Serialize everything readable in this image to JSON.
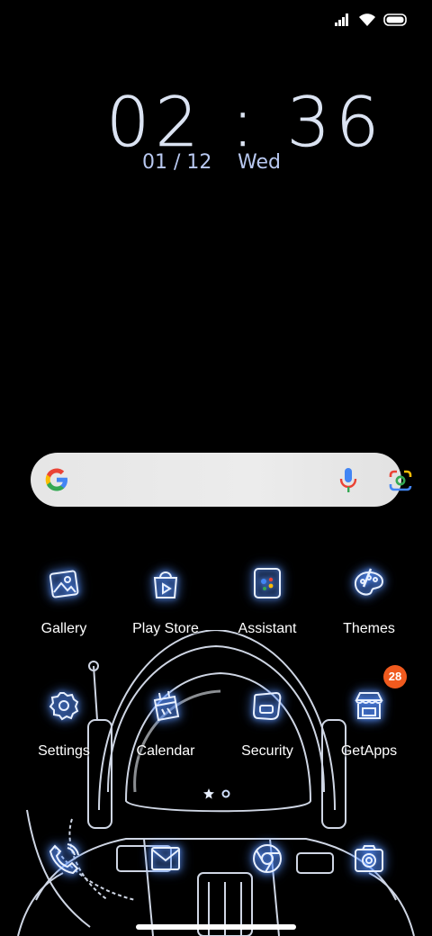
{
  "status_bar": {
    "signal_icon": "cell-signal-icon",
    "wifi_icon": "wifi-icon",
    "battery_icon": "battery-icon"
  },
  "clock": {
    "time": "02 : 36",
    "date": "01 / 12",
    "day": "Wed"
  },
  "search": {
    "google_icon": "google-g-icon",
    "mic_icon": "mic-icon",
    "lens_icon": "google-lens-icon"
  },
  "apps": [
    {
      "label": "Gallery",
      "icon": "gallery-icon"
    },
    {
      "label": "Play Store",
      "icon": "play-store-icon"
    },
    {
      "label": "Assistant",
      "icon": "assistant-icon"
    },
    {
      "label": "Themes",
      "icon": "themes-icon"
    },
    {
      "label": "Settings",
      "icon": "settings-icon"
    },
    {
      "label": "Calendar",
      "icon": "calendar-icon"
    },
    {
      "label": "Security",
      "icon": "security-icon"
    },
    {
      "label": "GetApps",
      "icon": "getapps-icon",
      "badge": "28"
    }
  ],
  "dock": [
    {
      "icon": "phone-icon"
    },
    {
      "icon": "messages-icon"
    },
    {
      "icon": "chrome-icon"
    },
    {
      "icon": "camera-icon"
    }
  ],
  "colors": {
    "accent_glow": "#3a7bff",
    "badge": "#f05a1e",
    "clock_text": "#dbe3f2"
  }
}
